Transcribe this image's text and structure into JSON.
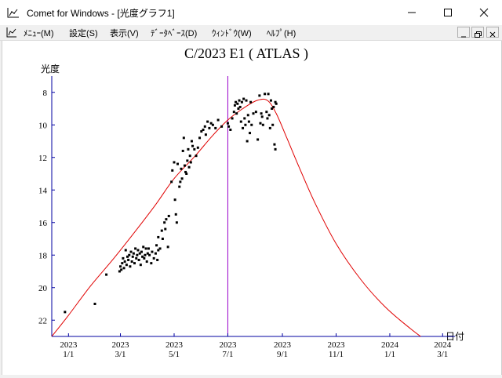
{
  "window": {
    "title": "Comet for Windows - [光度グラフ1]",
    "controls": [
      "minimize-icon",
      "maximize-icon",
      "close-icon"
    ]
  },
  "menubar": {
    "items": [
      {
        "id": "menu",
        "label": "ﾒﾆｭｰ(M)"
      },
      {
        "id": "settings",
        "label": "設定(S)"
      },
      {
        "id": "view",
        "label": "表示(V)"
      },
      {
        "id": "database",
        "label": "ﾃﾞｰﾀﾍﾞｰｽ(D)"
      },
      {
        "id": "window",
        "label": "ｳｨﾝﾄﾞｳ(W)"
      },
      {
        "id": "help",
        "label": "ﾍﾙﾌﾟ(H)"
      }
    ]
  },
  "chart_data": {
    "type": "scatter",
    "title": "C/2023 E1 ( ATLAS )",
    "ylabel": "光度",
    "xlabel": "日付",
    "y_inverted": true,
    "ylim": [
      23,
      7
    ],
    "xlim": [
      "2022-12-13",
      "2024-03-15"
    ],
    "y_ticks": [
      8,
      10,
      12,
      14,
      16,
      18,
      20,
      22
    ],
    "x_ticks": [
      {
        "date": "2023-01-01",
        "year": "2023",
        "md": "1/1"
      },
      {
        "date": "2023-03-01",
        "year": "2023",
        "md": "3/1"
      },
      {
        "date": "2023-05-01",
        "year": "2023",
        "md": "5/1"
      },
      {
        "date": "2023-07-01",
        "year": "2023",
        "md": "7/1"
      },
      {
        "date": "2023-09-01",
        "year": "2023",
        "md": "9/1"
      },
      {
        "date": "2023-11-01",
        "year": "2023",
        "md": "11/1"
      },
      {
        "date": "2024-01-01",
        "year": "2024",
        "md": "1/1"
      },
      {
        "date": "2024-03-01",
        "year": "2024",
        "md": "3/1"
      }
    ],
    "marker_date": "2023-07-01",
    "grid": false,
    "colors": {
      "curve": "#e00000",
      "points": "#000000",
      "axis": "#0000a0",
      "marker": "#9900cc"
    },
    "series": [
      {
        "type": "line",
        "points": [
          [
            "2022-12-13",
            23.0
          ],
          [
            "2023-01-01",
            21.7
          ],
          [
            "2023-01-26",
            19.9
          ],
          [
            "2023-02-20",
            18.3
          ],
          [
            "2023-03-17",
            16.6
          ],
          [
            "2023-04-10",
            14.9
          ],
          [
            "2023-05-01",
            13.3
          ],
          [
            "2023-05-25",
            11.9
          ],
          [
            "2023-06-13",
            10.7
          ],
          [
            "2023-07-01",
            9.7
          ],
          [
            "2023-07-18",
            9.0
          ],
          [
            "2023-08-03",
            8.5
          ],
          [
            "2023-08-15",
            8.5
          ],
          [
            "2023-08-25",
            9.3
          ],
          [
            "2023-09-06",
            10.8
          ],
          [
            "2023-09-20",
            12.6
          ],
          [
            "2023-10-08",
            14.8
          ],
          [
            "2023-11-01",
            17.3
          ],
          [
            "2023-11-29",
            19.5
          ],
          [
            "2023-12-27",
            21.2
          ],
          [
            "2024-01-24",
            22.5
          ],
          [
            "2024-02-15",
            23.4
          ],
          [
            "2024-03-01",
            24.0
          ]
        ]
      },
      {
        "type": "scatter",
        "points": [
          [
            "2022-12-28",
            21.5
          ],
          [
            "2023-01-31",
            21.0
          ],
          [
            "2023-02-13",
            19.2
          ],
          [
            "2023-02-28",
            19.0
          ],
          [
            "2023-03-01",
            18.7
          ],
          [
            "2023-03-02",
            18.9
          ],
          [
            "2023-03-03",
            18.5
          ],
          [
            "2023-03-04",
            18.2
          ],
          [
            "2023-03-05",
            18.8
          ],
          [
            "2023-03-06",
            18.4
          ],
          [
            "2023-03-07",
            17.7
          ],
          [
            "2023-03-08",
            18.6
          ],
          [
            "2023-03-09",
            18.1
          ],
          [
            "2023-03-10",
            18.3
          ],
          [
            "2023-03-11",
            18.0
          ],
          [
            "2023-03-12",
            18.7
          ],
          [
            "2023-03-13",
            17.8
          ],
          [
            "2023-03-14",
            18.4
          ],
          [
            "2023-03-15",
            18.1
          ],
          [
            "2023-03-16",
            17.9
          ],
          [
            "2023-03-17",
            18.5
          ],
          [
            "2023-03-18",
            17.6
          ],
          [
            "2023-03-19",
            18.2
          ],
          [
            "2023-03-20",
            18.0
          ],
          [
            "2023-03-21",
            17.7
          ],
          [
            "2023-03-22",
            18.3
          ],
          [
            "2023-03-23",
            17.9
          ],
          [
            "2023-03-24",
            18.6
          ],
          [
            "2023-03-25",
            17.8
          ],
          [
            "2023-03-26",
            18.1
          ],
          [
            "2023-03-27",
            17.5
          ],
          [
            "2023-03-28",
            18.2
          ],
          [
            "2023-03-29",
            18.0
          ],
          [
            "2023-03-30",
            17.6
          ],
          [
            "2023-03-31",
            18.4
          ],
          [
            "2023-04-01",
            17.9
          ],
          [
            "2023-04-02",
            17.6
          ],
          [
            "2023-04-03",
            18.0
          ],
          [
            "2023-04-05",
            18.5
          ],
          [
            "2023-04-06",
            17.8
          ],
          [
            "2023-04-08",
            18.2
          ],
          [
            "2023-04-10",
            17.9
          ],
          [
            "2023-04-11",
            17.4
          ],
          [
            "2023-04-12",
            18.3
          ],
          [
            "2023-04-13",
            17.7
          ],
          [
            "2023-04-15",
            17.6
          ],
          [
            "2023-04-13",
            16.9
          ],
          [
            "2023-04-17",
            16.5
          ],
          [
            "2023-04-18",
            17.0
          ],
          [
            "2023-04-20",
            16.0
          ],
          [
            "2023-04-21",
            16.4
          ],
          [
            "2023-04-22",
            15.8
          ],
          [
            "2023-04-24",
            17.5
          ],
          [
            "2023-04-25",
            15.6
          ],
          [
            "2023-04-28",
            13.5
          ],
          [
            "2023-04-29",
            12.8
          ],
          [
            "2023-05-01",
            12.3
          ],
          [
            "2023-05-02",
            14.6
          ],
          [
            "2023-05-03",
            15.5
          ],
          [
            "2023-05-04",
            16.0
          ],
          [
            "2023-05-05",
            12.4
          ],
          [
            "2023-05-07",
            13.8
          ],
          [
            "2023-05-08",
            13.5
          ],
          [
            "2023-05-09",
            12.7
          ],
          [
            "2023-05-10",
            13.3
          ],
          [
            "2023-05-11",
            11.6
          ],
          [
            "2023-05-12",
            10.8
          ],
          [
            "2023-05-13",
            12.5
          ],
          [
            "2023-05-14",
            12.9
          ],
          [
            "2023-05-15",
            13.0
          ],
          [
            "2023-05-16",
            12.2
          ],
          [
            "2023-05-17",
            11.5
          ],
          [
            "2023-05-18",
            12.6
          ],
          [
            "2023-05-19",
            11.9
          ],
          [
            "2023-05-20",
            12.3
          ],
          [
            "2023-05-21",
            11.0
          ],
          [
            "2023-05-22",
            11.3
          ],
          [
            "2023-05-24",
            11.5
          ],
          [
            "2023-05-26",
            11.9
          ],
          [
            "2023-05-28",
            11.4
          ],
          [
            "2023-05-30",
            10.8
          ],
          [
            "2023-06-01",
            10.4
          ],
          [
            "2023-06-03",
            10.3
          ],
          [
            "2023-06-05",
            10.1
          ],
          [
            "2023-06-06",
            10.6
          ],
          [
            "2023-06-08",
            9.8
          ],
          [
            "2023-06-10",
            10.2
          ],
          [
            "2023-06-12",
            9.9
          ],
          [
            "2023-06-14",
            10.0
          ],
          [
            "2023-06-17",
            10.2
          ],
          [
            "2023-06-20",
            9.7
          ],
          [
            "2023-06-24",
            10.1
          ],
          [
            "2023-07-01",
            9.9
          ],
          [
            "2023-07-02",
            10.1
          ],
          [
            "2023-07-04",
            10.3
          ],
          [
            "2023-07-06",
            9.6
          ],
          [
            "2023-07-08",
            9.2
          ],
          [
            "2023-07-09",
            8.8
          ],
          [
            "2023-07-10",
            8.6
          ],
          [
            "2023-07-11",
            9.3
          ],
          [
            "2023-07-12",
            8.7
          ],
          [
            "2023-07-13",
            9.0
          ],
          [
            "2023-07-14",
            8.5
          ],
          [
            "2023-07-15",
            8.9
          ],
          [
            "2023-07-16",
            9.8
          ],
          [
            "2023-07-17",
            8.6
          ],
          [
            "2023-07-18",
            10.2
          ],
          [
            "2023-07-19",
            8.4
          ],
          [
            "2023-07-20",
            9.6
          ],
          [
            "2023-07-21",
            10.0
          ],
          [
            "2023-07-22",
            8.5
          ],
          [
            "2023-07-23",
            11.0
          ],
          [
            "2023-07-24",
            9.4
          ],
          [
            "2023-07-25",
            9.8
          ],
          [
            "2023-07-26",
            10.5
          ],
          [
            "2023-07-27",
            8.6
          ],
          [
            "2023-07-28",
            10.0
          ],
          [
            "2023-07-30",
            9.3
          ],
          [
            "2023-08-02",
            9.2
          ],
          [
            "2023-08-04",
            10.9
          ],
          [
            "2023-08-06",
            8.2
          ],
          [
            "2023-08-07",
            9.9
          ],
          [
            "2023-08-08",
            9.3
          ],
          [
            "2023-08-09",
            9.5
          ],
          [
            "2023-08-10",
            10.0
          ],
          [
            "2023-08-12",
            8.1
          ],
          [
            "2023-08-14",
            9.2
          ],
          [
            "2023-08-15",
            9.6
          ],
          [
            "2023-08-16",
            8.1
          ],
          [
            "2023-08-17",
            9.4
          ],
          [
            "2023-08-18",
            10.2
          ],
          [
            "2023-08-19",
            8.5
          ],
          [
            "2023-08-20",
            9.0
          ],
          [
            "2023-08-21",
            10.0
          ],
          [
            "2023-08-22",
            8.9
          ],
          [
            "2023-08-23",
            11.2
          ],
          [
            "2023-08-24",
            8.6
          ],
          [
            "2023-08-24",
            11.5
          ],
          [
            "2023-08-25",
            8.7
          ]
        ]
      }
    ]
  }
}
